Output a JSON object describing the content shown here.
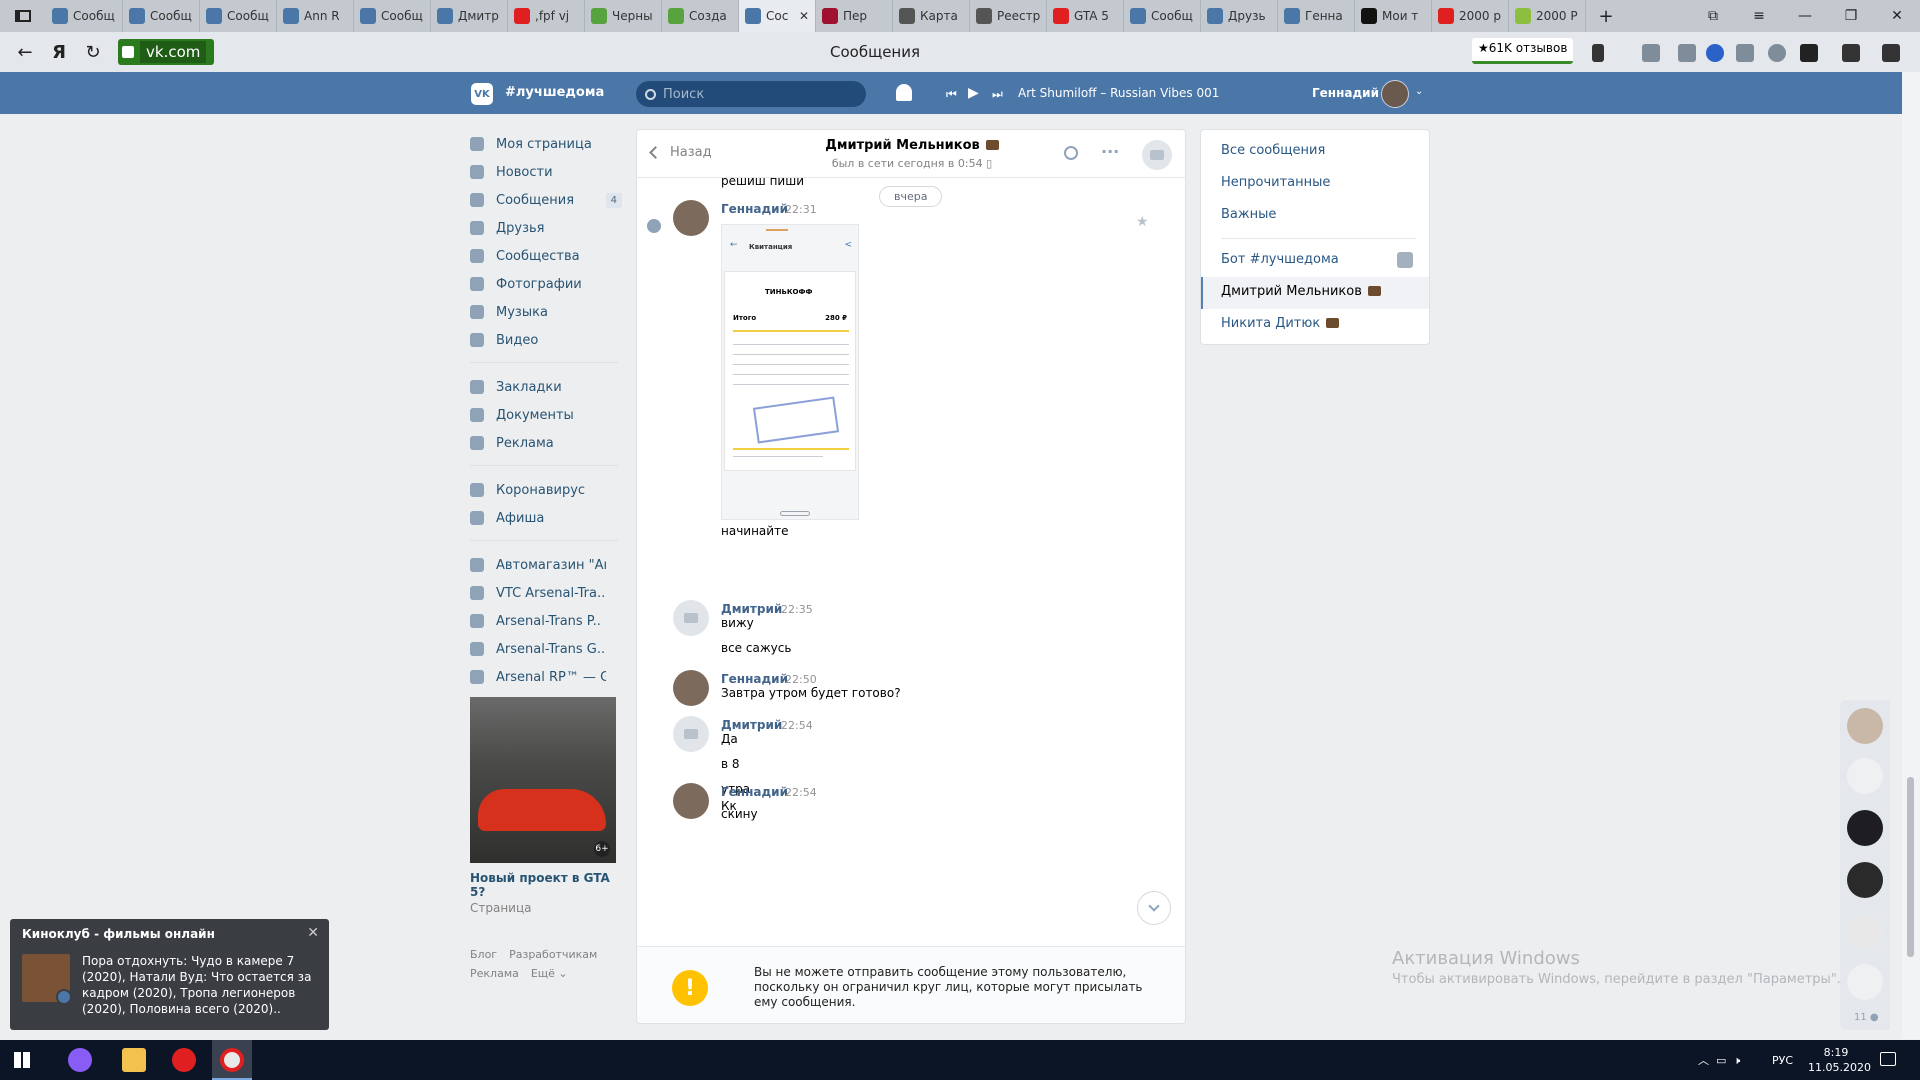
{
  "browser": {
    "tabs": [
      {
        "title": "Сообщ",
        "color": "#4a76a8"
      },
      {
        "title": "Сообщ",
        "color": "#4a76a8"
      },
      {
        "title": "Сообщ",
        "color": "#4a76a8"
      },
      {
        "title": "Ann R",
        "color": "#4a76a8"
      },
      {
        "title": "Сообщ",
        "color": "#4a76a8"
      },
      {
        "title": "Дмитр",
        "color": "#4a76a8"
      },
      {
        "title": ",fpf vj",
        "color": "#e02020"
      },
      {
        "title": "Черны",
        "color": "#58a33d"
      },
      {
        "title": "Созда",
        "color": "#58a33d"
      },
      {
        "title": "Сос",
        "color": "#4a76a8",
        "active": true
      },
      {
        "title": "Пер",
        "color": "#a01030"
      },
      {
        "title": "Карта",
        "color": "#555555"
      },
      {
        "title": "Реестр",
        "color": "#555555"
      },
      {
        "title": "GTA 5",
        "color": "#e02020"
      },
      {
        "title": "Сообщ",
        "color": "#4a76a8"
      },
      {
        "title": "Друзь",
        "color": "#4a76a8"
      },
      {
        "title": "Генна",
        "color": "#4a76a8"
      },
      {
        "title": "Мои т",
        "color": "#111111"
      },
      {
        "title": "2000 р",
        "color": "#e02020"
      },
      {
        "title": "2000 Р",
        "color": "#8cbf3f"
      }
    ],
    "new_tab": "+",
    "url": "vk.com",
    "page_title": "Сообщения",
    "reviews": "★61K отзывов"
  },
  "vk": {
    "brand": "#лучшедома",
    "search_placeholder": "Поиск",
    "track": "Art Shumiloff – Russian Vibes 001",
    "user_name": "Геннадий"
  },
  "nav": {
    "main": [
      {
        "label": "Моя страница"
      },
      {
        "label": "Новости"
      },
      {
        "label": "Сообщения",
        "badge": "4"
      },
      {
        "label": "Друзья"
      },
      {
        "label": "Сообщества"
      },
      {
        "label": "Фотографии"
      },
      {
        "label": "Музыка"
      },
      {
        "label": "Видео"
      }
    ],
    "secondary": [
      {
        "label": "Закладки"
      },
      {
        "label": "Документы"
      },
      {
        "label": "Реклама"
      }
    ],
    "extra": [
      {
        "label": "Коронавирус"
      },
      {
        "label": "Афиша"
      }
    ],
    "groups": [
      {
        "label": "Автомагазин \"Ан.."
      },
      {
        "label": "VTC Arsenal-Tra.."
      },
      {
        "label": "Arsenal-Trans P.."
      },
      {
        "label": "Arsenal-Trans G.."
      },
      {
        "label": "Arsenal RP™ — G.."
      }
    ],
    "ad": {
      "age": "6+",
      "title": "Новый проект в GTA 5?",
      "subtitle": "Страница"
    },
    "footer": [
      "Блог",
      "Разработчикам",
      "Реклама",
      "Ещё ⌄"
    ]
  },
  "chat": {
    "back": "Назад",
    "peer": "Дмитрий Мельников",
    "status": "был в сети сегодня в 0:54",
    "prev_line": "решиш пиши",
    "date": "вчера",
    "receipt": {
      "header": "Квитанция",
      "bank": "ТИНЬКОФФ",
      "total_label": "Итого",
      "total_value": "280 ₽"
    },
    "messages": [
      {
        "author": "Геннадий",
        "time": "22:31",
        "who": "g",
        "lines": [
          "начинайте"
        ]
      },
      {
        "author": "Дмитрий",
        "time": "22:35",
        "who": "d",
        "lines": [
          "вижу",
          "все сажусь"
        ]
      },
      {
        "author": "Геннадий",
        "time": "22:50",
        "who": "g",
        "lines": [
          "Завтра утром будет готово?"
        ]
      },
      {
        "author": "Дмитрий",
        "time": "22:54",
        "who": "d",
        "lines": [
          "Да",
          "в 8",
          "утра",
          "скину"
        ]
      },
      {
        "author": "Геннадий",
        "time": "22:54",
        "who": "g",
        "lines": [
          "Кк"
        ]
      }
    ],
    "warning": "Вы не можете отправить сообщение этому пользователю, поскольку он ограничил круг лиц, которые могут присылать ему сообщения."
  },
  "filters": {
    "items": [
      "Все сообщения",
      "Непрочитанные",
      "Важные"
    ],
    "chats": [
      "Бот #лучшедома",
      "Дмитрий Мельников",
      "Никита Дитюк"
    ]
  },
  "contacts_count": "11",
  "watermark": {
    "title": "Активация Windows",
    "subtitle": "Чтобы активировать Windows, перейдите в раздел \"Параметры\"."
  },
  "popup": {
    "title": "Киноклуб - фильмы онлайн",
    "text": "Пора отдохнуть: Чудо в камере 7 (2020), Натали Вуд: Что остается за кадром (2020), Тропа легионеров (2020), Половина всего (2020).."
  },
  "taskbar": {
    "lang": "РУС",
    "time": "8:19",
    "date": "11.05.2020"
  }
}
